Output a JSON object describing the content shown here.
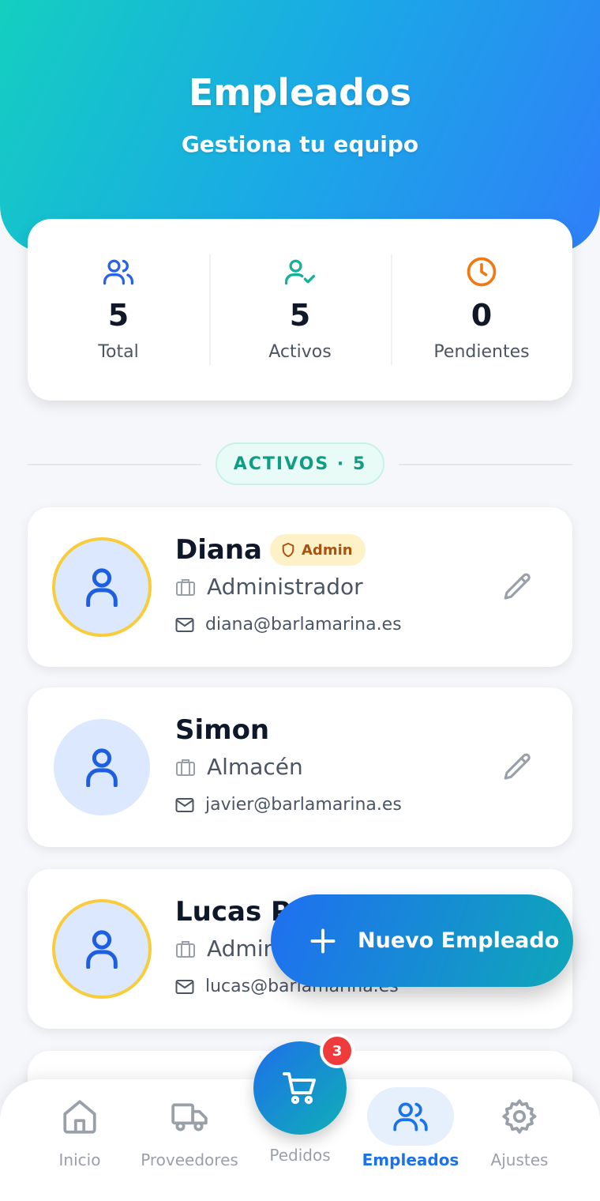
{
  "header": {
    "title": "Empleados",
    "subtitle": "Gestiona tu equipo"
  },
  "stats": [
    {
      "value": "5",
      "label": "Total",
      "icon": "users-icon",
      "color": "#2563eb"
    },
    {
      "value": "5",
      "label": "Activos",
      "icon": "user-check-icon",
      "color": "#10b39a"
    },
    {
      "value": "0",
      "label": "Pendientes",
      "icon": "clock-icon",
      "color": "#f07a12"
    }
  ],
  "section": {
    "label": "ACTIVOS · 5"
  },
  "employees": [
    {
      "name": "Diana",
      "badge": "Admin",
      "role": "Administrador",
      "email": "diana@barlamarina.es",
      "is_admin": true
    },
    {
      "name": "Simon",
      "badge": "",
      "role": "Almacén",
      "email": "javier@barlamarina.es",
      "is_admin": false
    },
    {
      "name": "Lucas P",
      "badge": "",
      "role": "Admin",
      "email": "lucas@barlamarina.es",
      "is_admin": true
    }
  ],
  "fab": {
    "label": "Nuevo Empleado"
  },
  "cart": {
    "badge": "3"
  },
  "nav": {
    "items": [
      {
        "label": "Inicio",
        "icon": "home-icon"
      },
      {
        "label": "Proveedores",
        "icon": "truck-icon"
      },
      {
        "label": "Pedidos",
        "icon": "cart-icon"
      },
      {
        "label": "Empleados",
        "icon": "users-icon",
        "active": true
      },
      {
        "label": "Ajustes",
        "icon": "gear-icon"
      }
    ]
  },
  "colors": {
    "accent": "#1a73e8",
    "admin_ring": "#f8cc3a",
    "badge_red": "#ef3b3b"
  }
}
